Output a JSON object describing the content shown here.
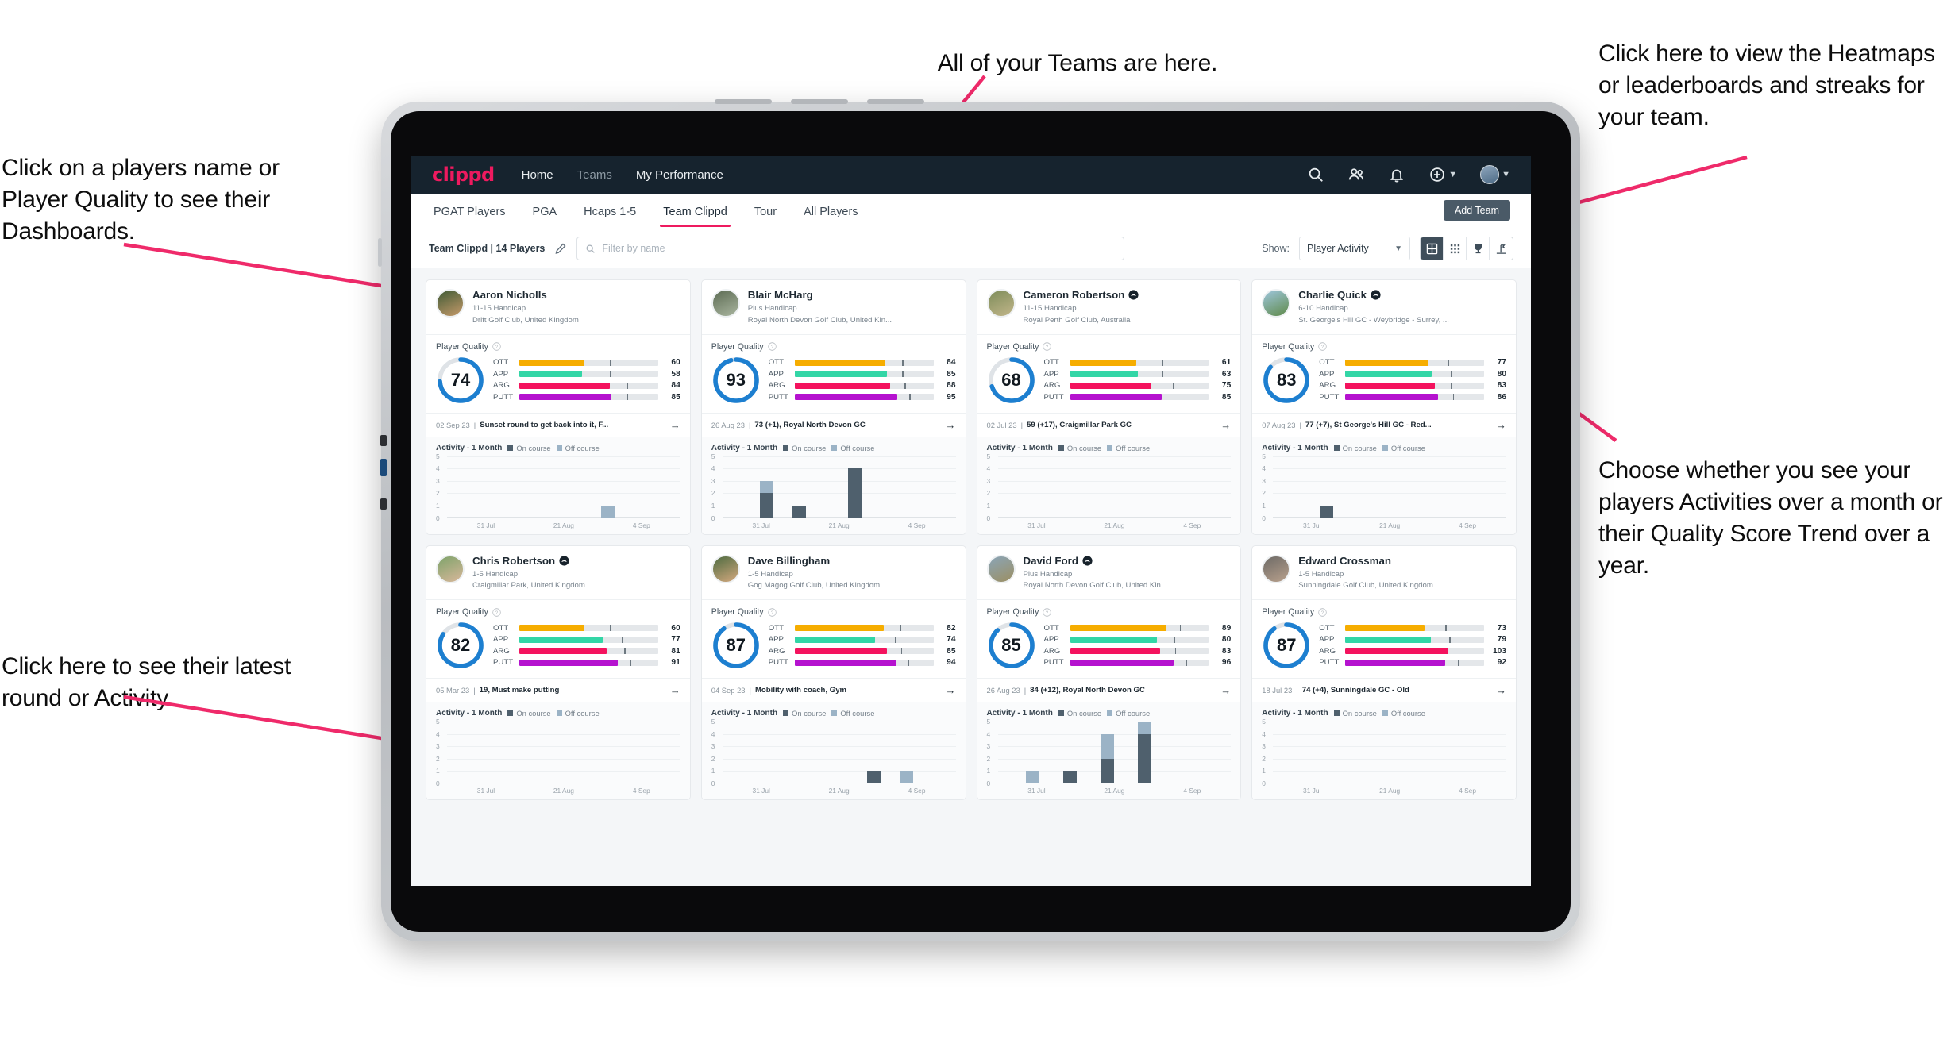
{
  "annotations": {
    "teams": "All of your Teams are here.",
    "left_top": "Click on a players name or Player Quality to see their Dashboards.",
    "left_bottom": "Click here to see their latest round or Activity.",
    "right_top": "Click here to view the Heatmaps or leaderboards and streaks for your team.",
    "right_bottom": "Choose whether you see your players Activities over a month or their Quality Score Trend over a year."
  },
  "app": {
    "logo": "clippd",
    "nav": [
      {
        "label": "Home",
        "active": true
      },
      {
        "label": "Teams",
        "active": false
      },
      {
        "label": "My Performance",
        "active": false
      }
    ],
    "icons": {
      "search": "search-icon",
      "people": "people-icon",
      "bell": "bell-icon",
      "plus": "plus-circle-icon",
      "avatar": "avatar"
    }
  },
  "tabs": [
    {
      "label": "PGAT Players",
      "active": false
    },
    {
      "label": "PGA",
      "active": false
    },
    {
      "label": "Hcaps 1-5",
      "active": false
    },
    {
      "label": "Team Clippd",
      "active": true
    },
    {
      "label": "Tour",
      "active": false
    },
    {
      "label": "All Players",
      "active": false
    }
  ],
  "add_team_button": "Add Team",
  "toolbar": {
    "team_label": "Team Clippd | 14 Players",
    "edit_icon": "pencil-icon",
    "search_placeholder": "Filter by name",
    "show_label": "Show:",
    "show_value": "Player Activity",
    "views": [
      {
        "name": "large-grid-view",
        "active": true
      },
      {
        "name": "small-grid-view",
        "active": false
      },
      {
        "name": "leaderboard-trophy-view",
        "active": false
      },
      {
        "name": "heatmap-view",
        "active": false
      }
    ]
  },
  "labels": {
    "player_quality": "Player Quality",
    "activity": "Activity - 1 Month",
    "on_course": "On course",
    "off_course": "Off course",
    "metrics": [
      "OTT",
      "APP",
      "ARG",
      "PUTT"
    ],
    "x_ticks": [
      "31 Jul",
      "21 Aug",
      "4 Sep"
    ]
  },
  "colors": {
    "brand": "#ee1a5f",
    "header_bg": "#16232e",
    "ring": "#1d7fd0",
    "ott": "#f6ad00",
    "app": "#33d6a6",
    "arg": "#f4135e",
    "putt": "#b512cf",
    "on_course": "#4f606d",
    "off_course": "#9bb3c6"
  },
  "players": [
    {
      "name": "Aaron Nicholls",
      "verified": false,
      "handicap": "11-15 Handicap",
      "club": "Drift Golf Club, United Kingdom",
      "quality": 74,
      "ring_pct": 74,
      "metrics": [
        {
          "key": "OTT",
          "value": 60,
          "pct": 60,
          "tick": 76
        },
        {
          "key": "APP",
          "value": 58,
          "pct": 58,
          "tick": 76
        },
        {
          "key": "ARG",
          "value": 84,
          "pct": 84,
          "tick": 90
        },
        {
          "key": "PUTT",
          "value": 85,
          "pct": 85,
          "tick": 90
        }
      ],
      "latest_date": "02 Sep 23",
      "latest_text": "Sunset round to get back into it, F...",
      "avatar_colors": [
        "#3f5a35",
        "#c69a6a"
      ],
      "chart": {
        "ymax": 5,
        "bars": [
          {
            "x": 66,
            "on": 0,
            "off": 1
          }
        ]
      }
    },
    {
      "name": "Blair McHarg",
      "verified": false,
      "handicap": "Plus Handicap",
      "club": "Royal North Devon Golf Club, United Kin...",
      "quality": 93,
      "ring_pct": 96,
      "metrics": [
        {
          "key": "OTT",
          "value": 84,
          "pct": 84,
          "tick": 90
        },
        {
          "key": "APP",
          "value": 85,
          "pct": 85,
          "tick": 90
        },
        {
          "key": "ARG",
          "value": 88,
          "pct": 88,
          "tick": 92
        },
        {
          "key": "PUTT",
          "value": 95,
          "pct": 95,
          "tick": 96
        }
      ],
      "latest_date": "26 Aug 23",
      "latest_text": "73 (+1), Royal North Devon GC",
      "avatar_colors": [
        "#5c6b53",
        "#aab6a0"
      ],
      "chart": {
        "ymax": 5,
        "bars": [
          {
            "x": 16,
            "on": 2,
            "off": 1
          },
          {
            "x": 30,
            "on": 1,
            "off": 0
          },
          {
            "x": 54,
            "on": 4,
            "off": 0
          }
        ]
      }
    },
    {
      "name": "Cameron Robertson",
      "verified": true,
      "handicap": "11-15 Handicap",
      "club": "Royal Perth Golf Club, Australia",
      "quality": 68,
      "ring_pct": 70,
      "metrics": [
        {
          "key": "OTT",
          "value": 61,
          "pct": 61,
          "tick": 77
        },
        {
          "key": "APP",
          "value": 63,
          "pct": 63,
          "tick": 77
        },
        {
          "key": "ARG",
          "value": 75,
          "pct": 75,
          "tick": 86
        },
        {
          "key": "PUTT",
          "value": 85,
          "pct": 85,
          "tick": 90
        }
      ],
      "latest_date": "02 Jul 23",
      "latest_text": "59 (+17), Craigmillar Park GC",
      "avatar_colors": [
        "#7d8c5a",
        "#c2b68a"
      ],
      "chart": {
        "ymax": 5,
        "bars": []
      }
    },
    {
      "name": "Charlie Quick",
      "verified": true,
      "handicap": "6-10 Handicap",
      "club": "St. George's Hill GC - Weybridge - Surrey, ...",
      "quality": 83,
      "ring_pct": 86,
      "metrics": [
        {
          "key": "OTT",
          "value": 77,
          "pct": 77,
          "tick": 86
        },
        {
          "key": "APP",
          "value": 80,
          "pct": 80,
          "tick": 88
        },
        {
          "key": "ARG",
          "value": 83,
          "pct": 83,
          "tick": 88
        },
        {
          "key": "PUTT",
          "value": 86,
          "pct": 86,
          "tick": 90
        }
      ],
      "latest_date": "07 Aug 23",
      "latest_text": "77 (+7), St George's Hill GC - Red...",
      "avatar_colors": [
        "#9ec6dd",
        "#5f8a4a"
      ],
      "chart": {
        "ymax": 5,
        "bars": [
          {
            "x": 20,
            "on": 1,
            "off": 0
          }
        ]
      }
    },
    {
      "name": "Chris Robertson",
      "verified": true,
      "handicap": "1-5 Handicap",
      "club": "Craigmillar Park, United Kingdom",
      "quality": 82,
      "ring_pct": 84,
      "metrics": [
        {
          "key": "OTT",
          "value": 60,
          "pct": 60,
          "tick": 76
        },
        {
          "key": "APP",
          "value": 77,
          "pct": 77,
          "tick": 86
        },
        {
          "key": "ARG",
          "value": 81,
          "pct": 81,
          "tick": 88
        },
        {
          "key": "PUTT",
          "value": 91,
          "pct": 91,
          "tick": 93
        }
      ],
      "latest_date": "05 Mar 23",
      "latest_text": "19, Must make putting",
      "avatar_colors": [
        "#7ea36a",
        "#d8b79a"
      ],
      "chart": {
        "ymax": 5,
        "bars": []
      }
    },
    {
      "name": "Dave Billingham",
      "verified": false,
      "handicap": "1-5 Handicap",
      "club": "Gog Magog Golf Club, United Kingdom",
      "quality": 87,
      "ring_pct": 90,
      "metrics": [
        {
          "key": "OTT",
          "value": 82,
          "pct": 82,
          "tick": 88
        },
        {
          "key": "APP",
          "value": 74,
          "pct": 74,
          "tick": 84
        },
        {
          "key": "ARG",
          "value": 85,
          "pct": 85,
          "tick": 89
        },
        {
          "key": "PUTT",
          "value": 94,
          "pct": 94,
          "tick": 95
        }
      ],
      "latest_date": "04 Sep 23",
      "latest_text": "Mobility with coach, Gym",
      "avatar_colors": [
        "#4e6b40",
        "#d3a87e"
      ],
      "chart": {
        "ymax": 5,
        "bars": [
          {
            "x": 62,
            "on": 1,
            "off": 0
          },
          {
            "x": 76,
            "on": 0,
            "off": 1
          }
        ]
      }
    },
    {
      "name": "David Ford",
      "verified": true,
      "handicap": "Plus Handicap",
      "club": "Royal North Devon Golf Club, United Kin...",
      "quality": 85,
      "ring_pct": 88,
      "metrics": [
        {
          "key": "OTT",
          "value": 89,
          "pct": 89,
          "tick": 92
        },
        {
          "key": "APP",
          "value": 80,
          "pct": 80,
          "tick": 87
        },
        {
          "key": "ARG",
          "value": 83,
          "pct": 83,
          "tick": 88
        },
        {
          "key": "PUTT",
          "value": 96,
          "pct": 96,
          "tick": 97
        }
      ],
      "latest_date": "26 Aug 23",
      "latest_text": "84 (+12), Royal North Devon GC",
      "avatar_colors": [
        "#8aa5b8",
        "#9c8f62"
      ],
      "chart": {
        "ymax": 5,
        "bars": [
          {
            "x": 12,
            "on": 0,
            "off": 1
          },
          {
            "x": 28,
            "on": 1,
            "off": 0
          },
          {
            "x": 44,
            "on": 2,
            "off": 2
          },
          {
            "x": 60,
            "on": 4,
            "off": 1
          }
        ]
      }
    },
    {
      "name": "Edward Crossman",
      "verified": false,
      "handicap": "1-5 Handicap",
      "club": "Sunningdale Golf Club, United Kingdom",
      "quality": 87,
      "ring_pct": 90,
      "metrics": [
        {
          "key": "OTT",
          "value": 73,
          "pct": 73,
          "tick": 84
        },
        {
          "key": "APP",
          "value": 79,
          "pct": 79,
          "tick": 87
        },
        {
          "key": "ARG",
          "value": 103,
          "pct": 95,
          "tick": 98
        },
        {
          "key": "PUTT",
          "value": 92,
          "pct": 92,
          "tick": 94
        }
      ],
      "latest_date": "18 Jul 23",
      "latest_text": "74 (+4), Sunningdale GC - Old",
      "avatar_colors": [
        "#6d6a66",
        "#b8a08c"
      ],
      "chart": {
        "ymax": 5,
        "bars": []
      }
    }
  ]
}
